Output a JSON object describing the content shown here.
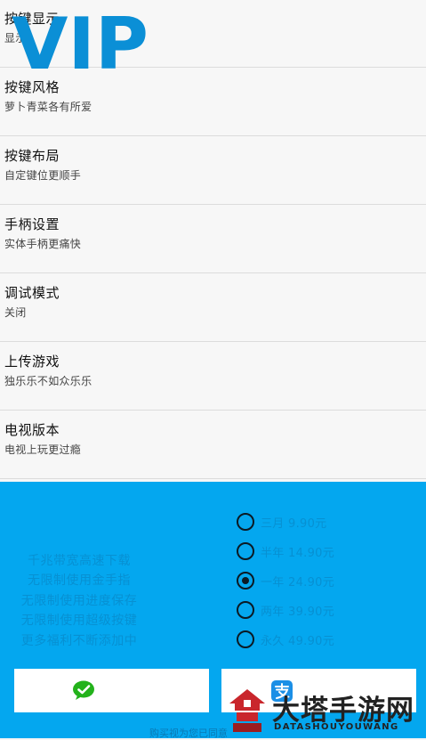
{
  "settings": [
    {
      "title": "按键显示",
      "subtitle": "显示"
    },
    {
      "title": "按键风格",
      "subtitle": "萝卜青菜各有所爱"
    },
    {
      "title": "按键布局",
      "subtitle": "自定键位更顺手"
    },
    {
      "title": "手柄设置",
      "subtitle": "实体手柄更痛快"
    },
    {
      "title": "调试模式",
      "subtitle": "关闭"
    },
    {
      "title": "上传游戏",
      "subtitle": "独乐乐不如众乐乐"
    },
    {
      "title": "电视版本",
      "subtitle": "电视上玩更过瘾"
    }
  ],
  "vip": {
    "logo_text": "VIP",
    "benefits": [
      "千兆带宽高速下载",
      "无限制使用金手指",
      "无限制使用进度保存",
      "无限制使用超级按键",
      "更多福利不断添加中"
    ],
    "plans": [
      {
        "label": "三月 9.90元",
        "selected": false
      },
      {
        "label": "半年 14.90元",
        "selected": false
      },
      {
        "label": "一年 24.90元",
        "selected": true
      },
      {
        "label": "两年 39.90元",
        "selected": false
      },
      {
        "label": "永久 49.90元",
        "selected": false
      }
    ],
    "agreement_text": "购买视为您已同意",
    "colors": {
      "panel": "#04a7ef",
      "text": "#0790d2",
      "wechat": "#23b21b",
      "alipay": "#1b8fe6"
    }
  },
  "payment": {
    "wechat_icon": "wechat-icon",
    "alipay_icon": "alipay-icon"
  },
  "watermark": {
    "title": "大塔手游网",
    "subtitle": "DATASHOUYOUWANG"
  }
}
